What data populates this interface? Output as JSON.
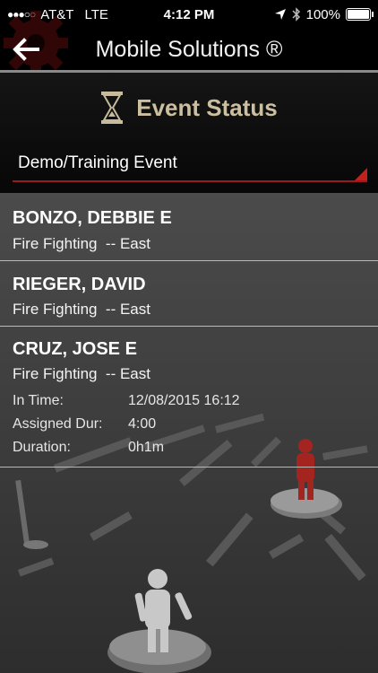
{
  "status_bar": {
    "signal": "●●●○○",
    "carrier": "AT&T",
    "network": "LTE",
    "time": "4:12 PM",
    "battery": "100%"
  },
  "nav": {
    "title": "Mobile Solutions ®"
  },
  "event": {
    "status_label": "Event Status",
    "selected_event": "Demo/Training Event"
  },
  "people": [
    {
      "name": "BONZO, DEBBIE E",
      "assignment": "Fire Fighting  -- East"
    },
    {
      "name": "RIEGER, DAVID",
      "assignment": "Fire Fighting  -- East"
    },
    {
      "name": "CRUZ, JOSE E",
      "assignment": "Fire Fighting  -- East",
      "details": [
        {
          "label": "In Time:",
          "value": "12/08/2015 16:12"
        },
        {
          "label": "Assigned Dur:",
          "value": "4:00"
        },
        {
          "label": "Duration:",
          "value": "0h1m"
        }
      ]
    }
  ],
  "colors": {
    "accent_red": "#c0201e",
    "event_status_gold": "#cbbf9f"
  }
}
